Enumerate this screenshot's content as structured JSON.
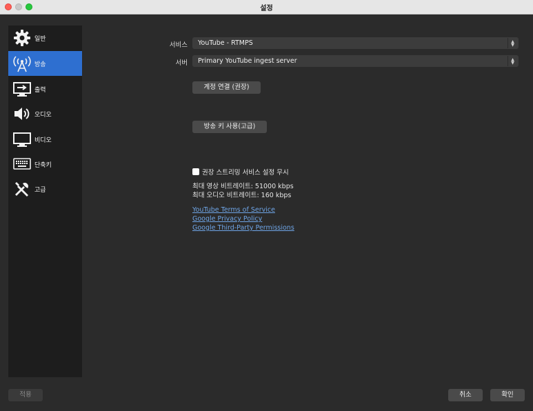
{
  "window": {
    "title": "설정"
  },
  "sidebar": {
    "items": [
      {
        "label": "일반",
        "icon": "gear-icon",
        "active": false
      },
      {
        "label": "방송",
        "icon": "antenna-icon",
        "active": true
      },
      {
        "label": "출력",
        "icon": "output-monitor-icon",
        "active": false
      },
      {
        "label": "오디오",
        "icon": "speaker-icon",
        "active": false
      },
      {
        "label": "비디오",
        "icon": "monitor-icon",
        "active": false
      },
      {
        "label": "단축키",
        "icon": "keyboard-icon",
        "active": false
      },
      {
        "label": "고급",
        "icon": "tools-icon",
        "active": false
      }
    ]
  },
  "stream": {
    "service_label": "서비스",
    "service_value": "YouTube - RTMPS",
    "server_label": "서버",
    "server_value": "Primary YouTube ingest server",
    "connect_account_button": "계정 연결 (권장)",
    "use_stream_key_button": "방송 키 사용(고급)",
    "ignore_recommended_label": "권장 스트리밍 서비스 설정 무시",
    "ignore_recommended_checked": false,
    "max_video_bitrate": "최대 영상 비트레이트: 51000 kbps",
    "max_audio_bitrate": "최대 오디오 비트레이트: 160 kbps",
    "links": [
      "YouTube Terms of Service",
      "Google Privacy Policy",
      "Google Third-Party Permissions"
    ]
  },
  "footer": {
    "apply_button": "적용",
    "cancel_button": "취소",
    "ok_button": "확인"
  },
  "colors": {
    "accent": "#2e6fd0",
    "link": "#6fa6e8",
    "background": "#2b2b2b",
    "sidebar": "#1d1d1d"
  }
}
